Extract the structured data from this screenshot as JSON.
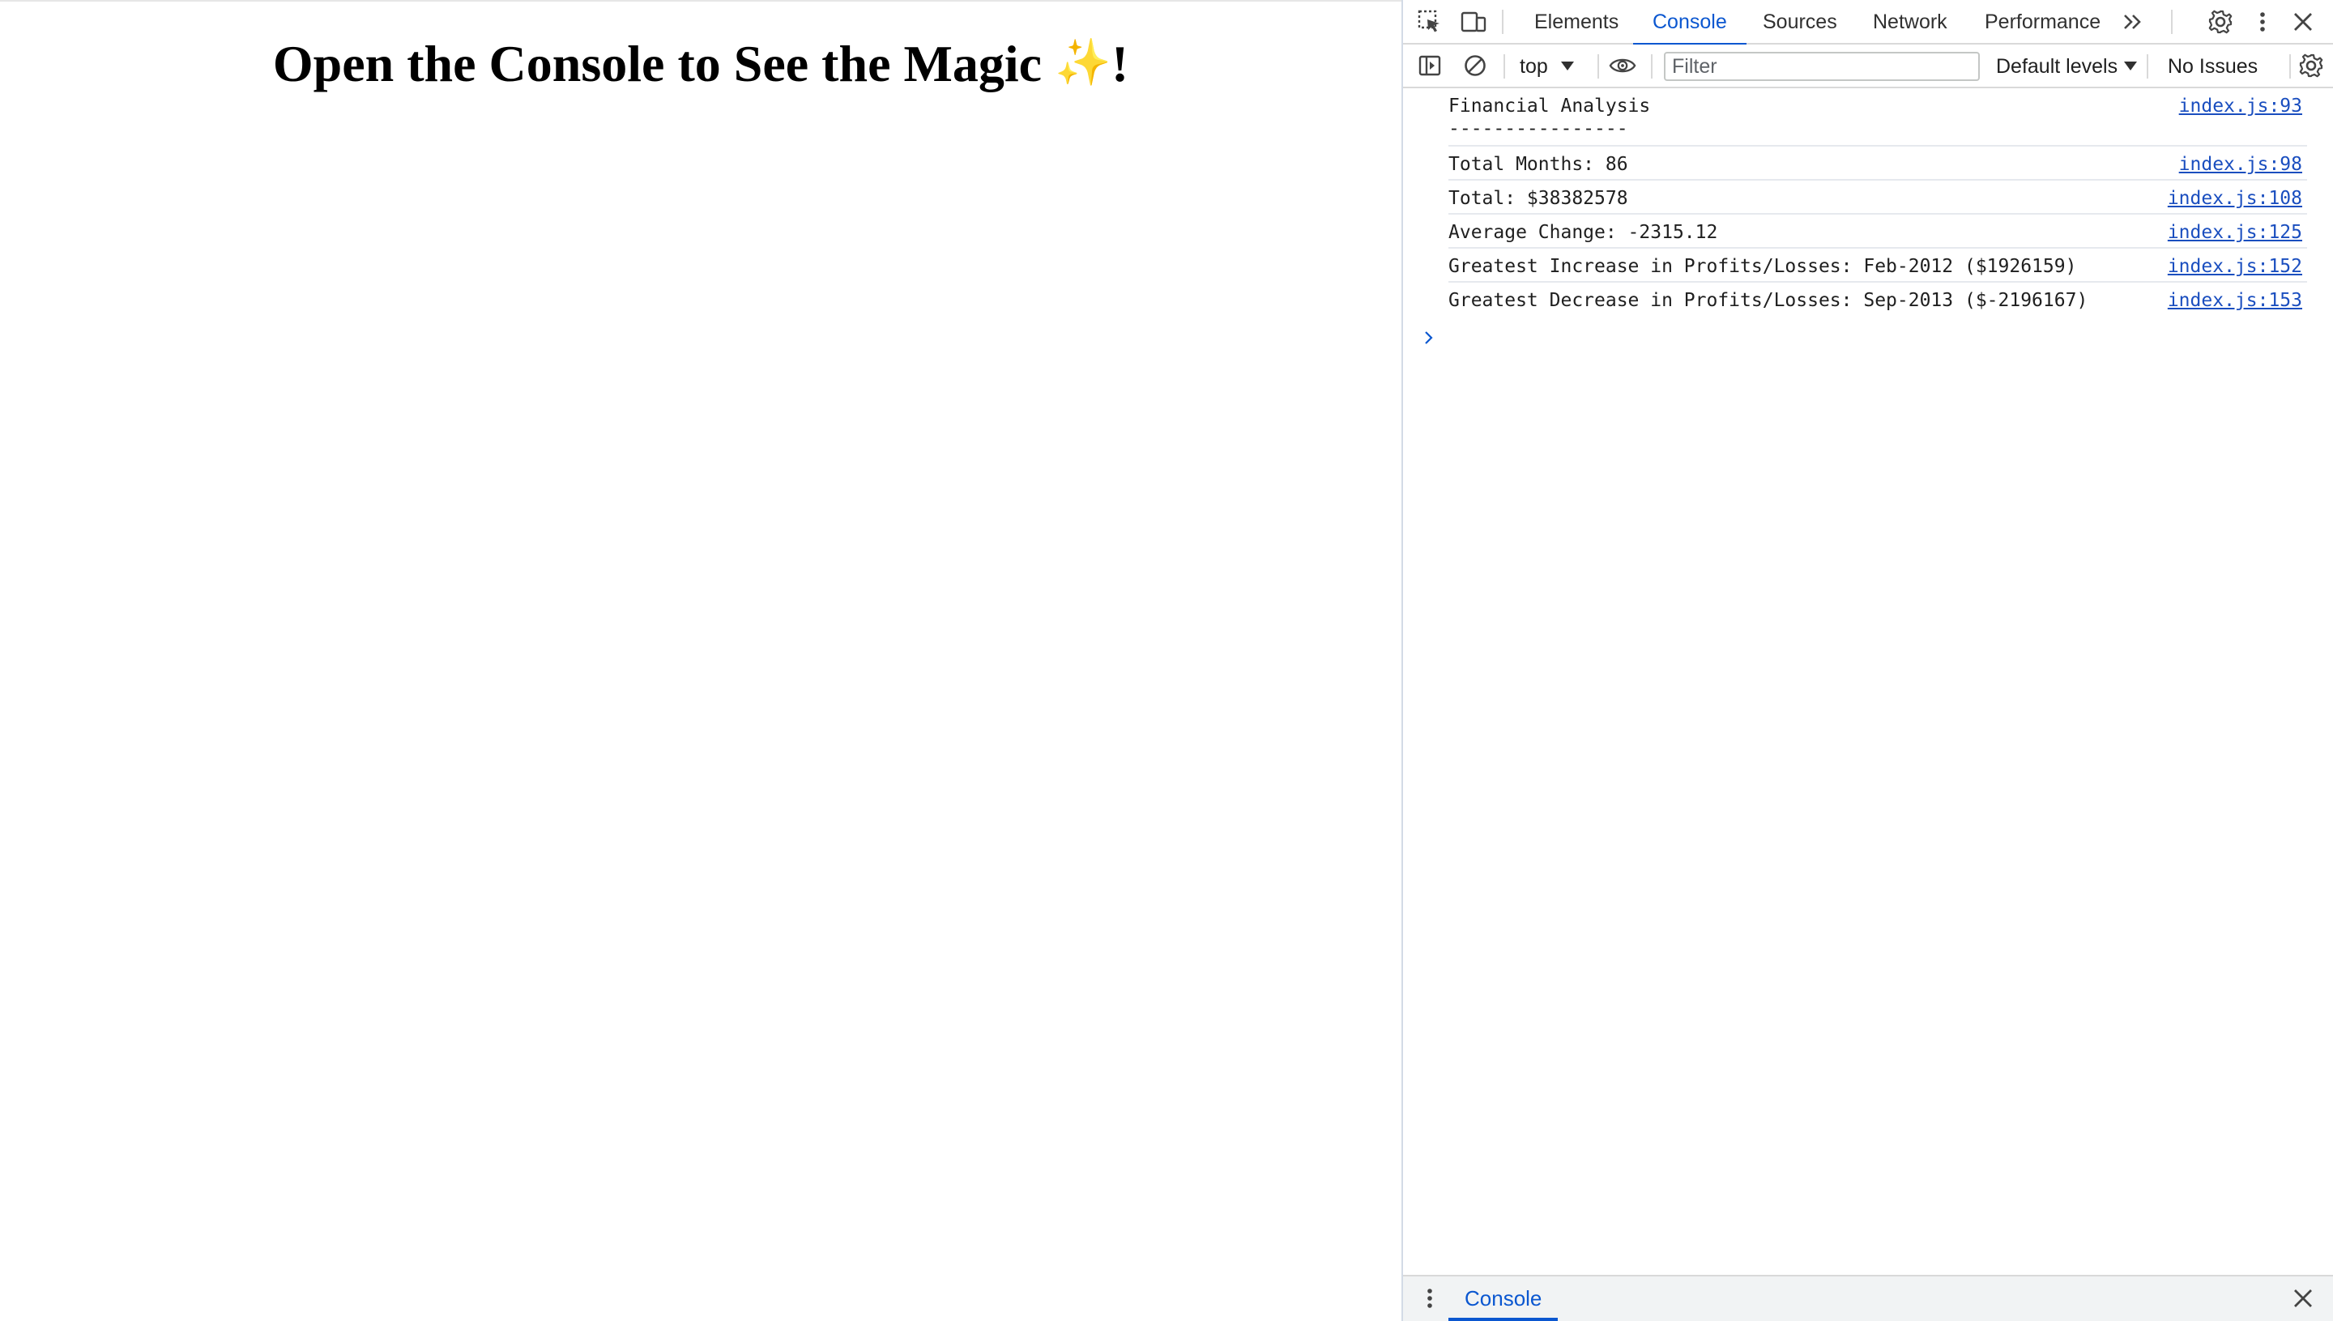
{
  "page": {
    "heading": "Open the Console to See the Magic",
    "heading_emoji": "✨",
    "heading_suffix": "!"
  },
  "devtools": {
    "tabs": [
      {
        "label": "Elements",
        "active": false
      },
      {
        "label": "Console",
        "active": true
      },
      {
        "label": "Sources",
        "active": false
      },
      {
        "label": "Network",
        "active": false
      },
      {
        "label": "Performance",
        "active": false
      }
    ],
    "toolbar": {
      "context": "top",
      "filter_placeholder": "Filter",
      "levels": "Default levels",
      "issues": "No Issues"
    },
    "messages": [
      {
        "text": "Financial Analysis\n----------------",
        "source": "index.js:93"
      },
      {
        "text": "Total Months: 86",
        "source": "index.js:98"
      },
      {
        "text": "Total: $38382578",
        "source": "index.js:108"
      },
      {
        "text": "Average Change: -2315.12",
        "source": "index.js:125"
      },
      {
        "text": "Greatest Increase in Profits/Losses: Feb-2012 ($1926159)",
        "source": "index.js:152"
      },
      {
        "text": "Greatest Decrease in Profits/Losses: Sep-2013 ($-2196167)",
        "source": "index.js:153"
      }
    ],
    "drawer": {
      "tab_label": "Console"
    },
    "colors": {
      "accent": "#0b57d0",
      "link": "#1a4ebf"
    }
  }
}
